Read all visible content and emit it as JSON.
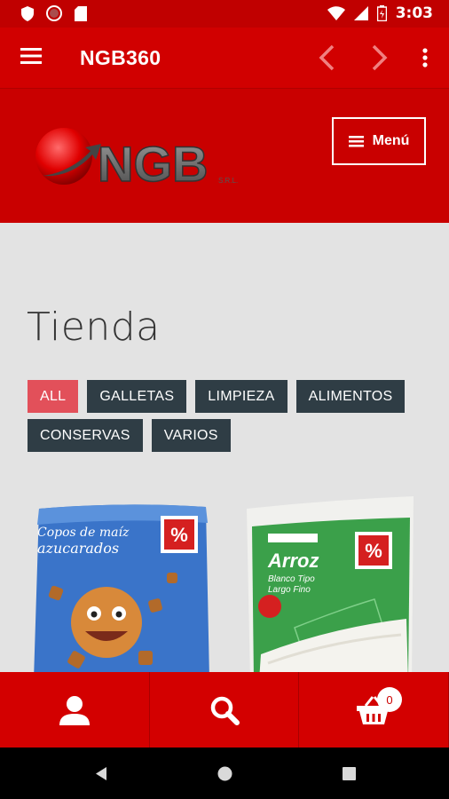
{
  "status_bar": {
    "time": "3:03"
  },
  "app_bar": {
    "title": "NGB360"
  },
  "site_header": {
    "menu_label": "Menú",
    "logo_text": "NGB",
    "logo_suffix": "S.R.L."
  },
  "shop": {
    "title": "Tienda",
    "filters": [
      "ALL",
      "GALLETAS",
      "LIMPIEZA",
      "ALIMENTOS",
      "CONSERVAS",
      "VARIOS"
    ],
    "active_filter": "ALL"
  },
  "products": [
    {
      "brand_lines": [
        "Copos de maíz",
        "azucarados"
      ]
    },
    {
      "name": "Arroz",
      "sub": [
        "Blanco Tipo",
        "Largo Fino"
      ]
    }
  ],
  "cart": {
    "count": "0"
  },
  "colors": {
    "primary": "#d10000",
    "chip": "#2f3d45",
    "chip_active": "#e2505a"
  }
}
